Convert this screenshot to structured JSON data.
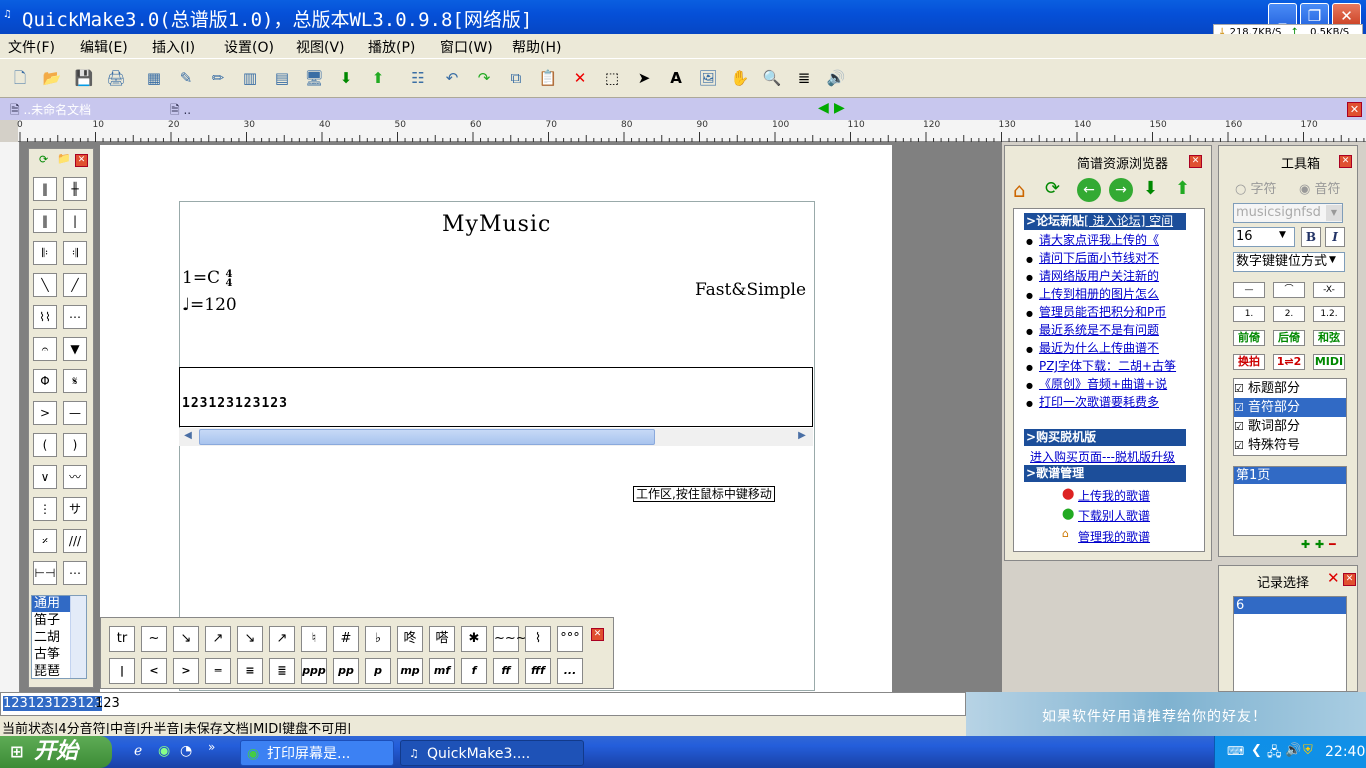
{
  "window": {
    "title": "QuickMake3.0(总谱版1.0)，总版本WL3.0.9.8[网络版]",
    "net_down": "218.7KB/S",
    "net_up": "0.5KB/S"
  },
  "menu": [
    "文件(F)",
    "编辑(E)",
    "插入(I)",
    "设置(O)",
    "视图(V)",
    "播放(P)",
    "窗口(W)",
    "帮助(H)"
  ],
  "doc_tabs": [
    "..未命名文档",
    ".."
  ],
  "ruler": [
    "0",
    "10",
    "20",
    "30",
    "40",
    "50",
    "60",
    "70",
    "80",
    "90",
    "100",
    "110",
    "120",
    "130",
    "140",
    "150",
    "160",
    "170"
  ],
  "score": {
    "title": "MyMusic",
    "key": "1=C",
    "time_top": "4",
    "time_bottom": "4",
    "tempo": "♩=120",
    "composer": "Fast&Simple",
    "notes": "123123123123"
  },
  "tooltip": "工作区,按住鼠标中键移动",
  "left_palette": {
    "list": [
      "通用",
      "笛子",
      "二胡",
      "古筝",
      "琵琶"
    ]
  },
  "bottom_palette": {
    "row1": [
      "tr",
      "~",
      "↘",
      "↗",
      "↘",
      "↗",
      "♮",
      "#",
      "♭",
      "咚",
      "嗒",
      "✱",
      "~~~",
      "⌇",
      "°°°"
    ],
    "row2": [
      "|",
      "<",
      ">",
      "═",
      "≡",
      "≣",
      "ppp",
      "pp",
      "p",
      "mp",
      "mf",
      "f",
      "ff",
      "fff",
      "..."
    ]
  },
  "browser": {
    "title": "简谱资源浏览器",
    "forum_header": "论坛新贴",
    "forum_link": "[ 进入论坛] 空间",
    "posts": [
      "请大家点评我上传的《",
      "请问下后面小节线对不",
      "请网络版用户关注新的",
      "上传到相册的图片怎么",
      "管理员能否把积分和P币",
      "最近系统是不是有问题",
      "最近为什么上传曲谱不",
      "PZJ字体下载：二胡+古筝",
      "《原创》音频+曲谱+说",
      "打印一次歌谱要耗费多"
    ],
    "buy_header": "购买脱机版",
    "buy_text": "进入购买页面---",
    "buy_link": "脱机版升级",
    "manage_header": "歌谱管理",
    "manage_items": [
      "上传我的歌谱",
      "下载别人歌谱",
      "管理我的歌谱"
    ]
  },
  "toolbox": {
    "title": "工具箱",
    "radio_char": "字符",
    "radio_note": "音符",
    "font": "musicsignfsd",
    "size": "16",
    "bold": "B",
    "italic": "I",
    "mode": "数字键键位方式",
    "buttons": [
      "前倚",
      "后倚",
      "和弦",
      "换拍",
      "1⇌2",
      "MIDI"
    ],
    "checks": [
      "标题部分",
      "音符部分",
      "歌词部分",
      "特殊符号"
    ],
    "page": "第1页"
  },
  "records": {
    "title": "记录选择",
    "item": "6"
  },
  "input": {
    "selected": "123123123123",
    "rest": "123"
  },
  "status": "当前状态|4分音符|中音|升半音|未保存文档|MIDI键盘不可用|",
  "banner": "如果软件好用请推荐给你的好友！",
  "taskbar": {
    "start": "开始",
    "tasks": [
      "打印屏幕是...",
      "QuickMake3...."
    ],
    "clock": "22:40"
  }
}
